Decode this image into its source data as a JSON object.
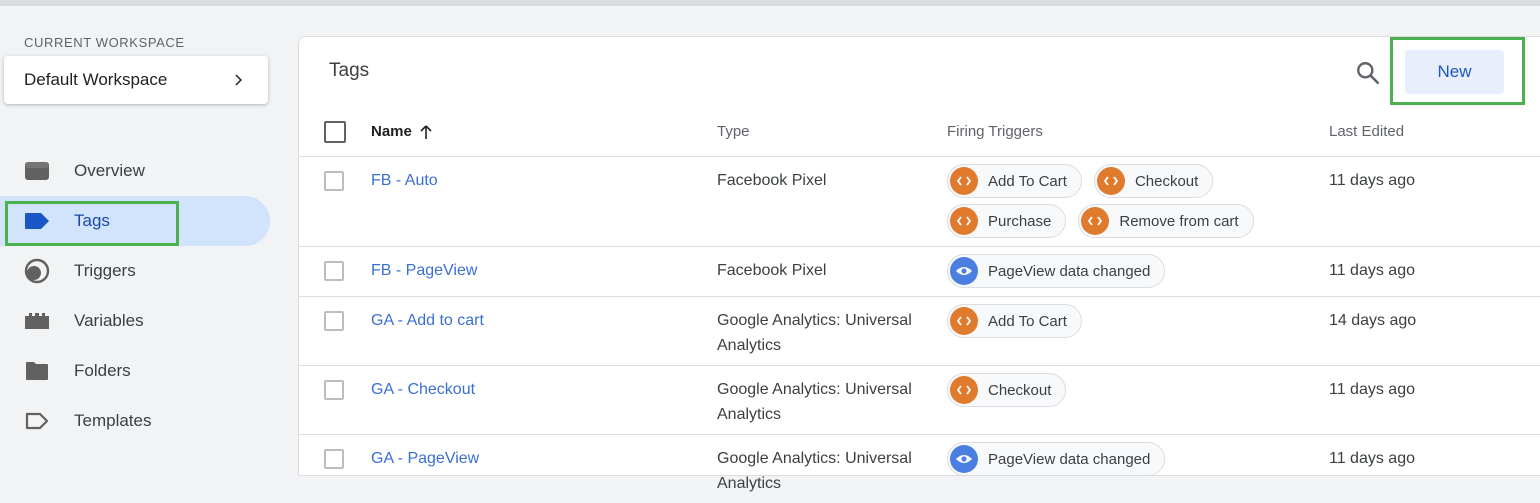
{
  "sidebar": {
    "workspace_label": "CURRENT WORKSPACE",
    "workspace_name": "Default Workspace",
    "items": [
      {
        "label": "Overview",
        "icon": "overview-icon"
      },
      {
        "label": "Tags",
        "icon": "tag-icon",
        "active": true
      },
      {
        "label": "Triggers",
        "icon": "trigger-icon"
      },
      {
        "label": "Variables",
        "icon": "variables-icon"
      },
      {
        "label": "Folders",
        "icon": "folder-icon"
      },
      {
        "label": "Templates",
        "icon": "template-icon"
      }
    ]
  },
  "main": {
    "title": "Tags",
    "new_button": "New",
    "columns": {
      "name": "Name",
      "type": "Type",
      "triggers": "Firing Triggers",
      "edited": "Last Edited"
    },
    "rows": [
      {
        "name": "FB - Auto",
        "type": "Facebook Pixel",
        "triggers": [
          {
            "label": "Add To Cart",
            "kind": "custom"
          },
          {
            "label": "Checkout",
            "kind": "custom"
          },
          {
            "label": "Purchase",
            "kind": "custom"
          },
          {
            "label": "Remove from cart",
            "kind": "custom"
          }
        ],
        "edited": "11 days ago"
      },
      {
        "name": "FB - PageView",
        "type": "Facebook Pixel",
        "triggers": [
          {
            "label": "PageView data changed",
            "kind": "view"
          }
        ],
        "edited": "11 days ago"
      },
      {
        "name": "GA - Add to cart",
        "type": "Google Analytics: Universal Analytics",
        "triggers": [
          {
            "label": "Add To Cart",
            "kind": "custom"
          }
        ],
        "edited": "14 days ago"
      },
      {
        "name": "GA - Checkout",
        "type": "Google Analytics: Universal Analytics",
        "triggers": [
          {
            "label": "Checkout",
            "kind": "custom"
          }
        ],
        "edited": "11 days ago"
      },
      {
        "name": "GA - PageView",
        "type": "Google Analytics: Universal Analytics",
        "triggers": [
          {
            "label": "PageView data changed",
            "kind": "view"
          }
        ],
        "edited": "11 days ago"
      }
    ]
  },
  "colors": {
    "accent": "#1a57c5",
    "link": "#3b6fd6",
    "custom_trigger": "#e07a2c",
    "view_trigger": "#4a7ee0",
    "highlight": "#4caf50"
  }
}
